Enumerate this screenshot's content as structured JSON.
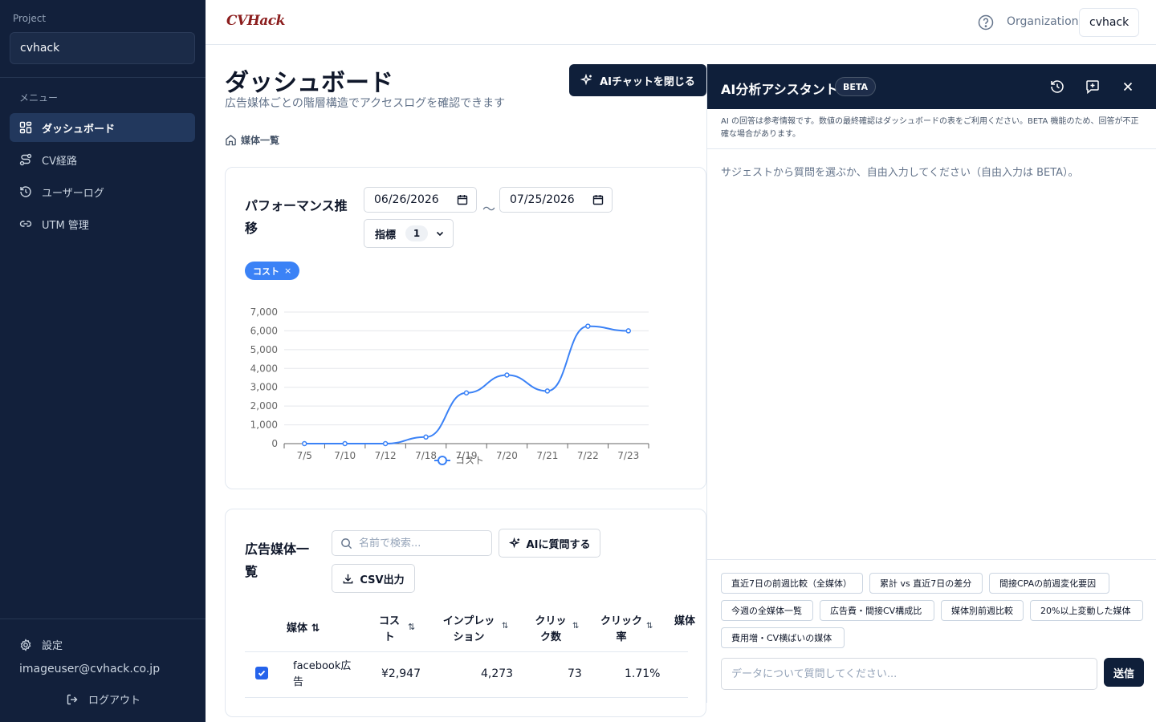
{
  "sidebar": {
    "project_label": "Project",
    "project_name": "cvhack",
    "menu_label": "メニュー",
    "items": [
      {
        "label": "ダッシュボード",
        "icon": "dashboard-icon",
        "active": true
      },
      {
        "label": "CV経路",
        "icon": "route-icon",
        "active": false
      },
      {
        "label": "ユーザーログ",
        "icon": "history-icon",
        "active": false
      },
      {
        "label": "UTM 管理",
        "icon": "link-icon",
        "active": false
      }
    ],
    "settings_label": "設定",
    "user_email": "imageuser@cvhack.co.jp",
    "logout_label": "ログアウト"
  },
  "header": {
    "logo_text": "CVHack",
    "org_label": "Organization",
    "org_name": "cvhack"
  },
  "main": {
    "title": "ダッシュボード",
    "subtitle": "広告媒体ごとの階層構造でアクセスログを確認できます",
    "close_chat_label": "AIチャットを閉じる",
    "breadcrumb": "媒体一覧"
  },
  "performance": {
    "title_line1": "パフォーマンス推",
    "title_line2": "移",
    "date_from": "06/26/2026",
    "date_to": "07/25/2026",
    "tilde": "〜",
    "metric_label": "指標",
    "metric_count": "1",
    "chip_label": "コスト",
    "chip_close": "×"
  },
  "chart_data": {
    "type": "line",
    "categories": [
      "7/5",
      "7/10",
      "7/12",
      "7/18",
      "7/19",
      "7/20",
      "7/21",
      "7/22",
      "7/23"
    ],
    "series": [
      {
        "name": "コスト",
        "values": [
          0,
          0,
          0,
          350,
          2700,
          3650,
          2800,
          6250,
          6000
        ],
        "color": "#3b82f6"
      }
    ],
    "y_ticks": [
      "0",
      "1,000",
      "2,000",
      "3,000",
      "4,000",
      "5,000",
      "6,000",
      "7,000"
    ],
    "ylim": [
      0,
      7000
    ],
    "grid": true,
    "legend": "bottom-center",
    "title": "",
    "xlabel": "",
    "ylabel": ""
  },
  "media_table": {
    "title_line1": "広告媒体一",
    "title_line2": "覧",
    "search_placeholder": "名前で検索...",
    "ai_button_label": "AIに質問する",
    "csv_button_label": "CSV出力",
    "columns": [
      {
        "line1": "媒体",
        "line2": ""
      },
      {
        "line1": "コス",
        "line2": "ト"
      },
      {
        "line1": "インプレッ",
        "line2": "ション"
      },
      {
        "line1": "クリッ",
        "line2": "ク数"
      },
      {
        "line1": "クリック",
        "line2": "率"
      },
      {
        "line1": "媒体",
        "line2": ""
      }
    ],
    "sort_glyph": "⇅",
    "rows": [
      {
        "media_line1": "facebook広",
        "media_line2": "告",
        "cost": "¥2,947",
        "impressions": "4,273",
        "clicks": "73",
        "ctr": "1.71%",
        "checked": true
      }
    ]
  },
  "chat": {
    "title": "AI分析アシスタント",
    "badge": "BETA",
    "disclaimer": "AI の回答は参考情報です。数値の最終確認はダッシュボードの表をご利用ください。BETA 機能のため、回答が不正確な場合があります。",
    "hint": "サジェストから質問を選ぶか、自由入力してください（自由入力は BETA）。",
    "suggestions": [
      "直近7日の前週比較（全媒体）",
      "累計 vs 直近7日の差分",
      "間接CPAの前週変化要因",
      "今週の全媒体一覧",
      "広告費・間接CV構成比",
      "媒体別前週比較",
      "20%以上変動した媒体",
      "費用増・CV横ばいの媒体"
    ],
    "input_placeholder": "データについて質問してください...",
    "send_label": "送信"
  },
  "colors": {
    "sidebar_bg": "#12203b",
    "accent": "#3b82f6",
    "dark_button": "#0f1f3a",
    "logo": "#8b1d1d"
  }
}
